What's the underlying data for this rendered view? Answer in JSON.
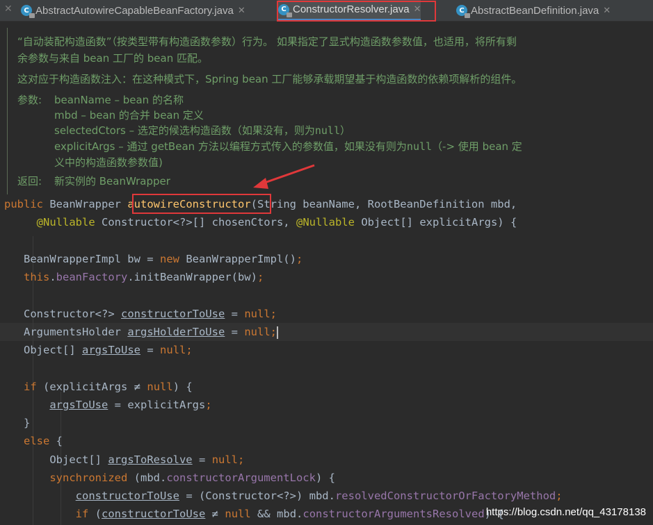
{
  "tabs": [
    {
      "label": "AbstractAutowireCapableBeanFactory.java",
      "icon": "C"
    },
    {
      "label": "ConstructorResolver.java",
      "icon": "C"
    },
    {
      "label": "AbstractBeanDefinition.java",
      "icon": "C"
    }
  ],
  "doc": {
    "line1": "“自动装配构造函数”（按类型带有构造函数参数）行为。 如果指定了显式构造函数参数值，也适用，将所有剩",
    "line2": "余参数与来自 bean 工厂的 bean 匹配。",
    "line3": "这对应于构造函数注入：在这种模式下，Spring bean 工厂能够承载期望基于构造函数的依赖项解析的组件。",
    "params_label": "参数:",
    "p1": "beanName – bean 的名称",
    "p2": "mbd – bean 的合并 bean 定义",
    "p3a": "selectedCtors – 选定的候选构造函数（如果没有，则为",
    "p3null": "null",
    "p3b": "）",
    "p4a": "explicitArgs – 通过 getBean 方法以编程方式传入的参数值，如果没有则为",
    "p4null": "null",
    "p4b": "（-> 使用 bean 定",
    "p5": "义中的构造函数参数值)",
    "returns_label": "返回:",
    "returns": "新实例的 BeanWrapper"
  },
  "code": {
    "kw_public": "public",
    "ret_type": "BeanWrapper",
    "method_name": "autowireConstructor",
    "sig_rest": "(String beanName, RootBeanDefinition mbd,",
    "ann_nullable": "@Nullable",
    "sig2_a": "Constructor<?>[] chosenCtors,",
    "sig2_b": "Object[] explicitArgs) {",
    "l4_a": "BeanWrapperImpl bw =",
    "kw_new": "new",
    "l4_b": "BeanWrapperImpl()",
    "semi": ";",
    "kw_this": "this",
    "dot": ".",
    "fld_beanFactory": "beanFactory",
    "l5_b": ".initBeanWrapper(bw)",
    "l7_a": "Constructor<?>",
    "var_constructorToUse": "constructorToUse",
    "eq": "=",
    "kw_null": "null",
    "l8_a": "ArgumentsHolder",
    "var_argsHolderToUse": "argsHolderToUse",
    "l9_a": "Object[]",
    "var_argsToUse": "argsToUse",
    "kw_if": "if",
    "l11_a": "(explicitArgs",
    "neq": "≠",
    "close_brace_open": ") {",
    "l12_b": "= explicitArgs",
    "rbrace": "}",
    "kw_else": "else",
    "lbrace": "{",
    "var_argsToResolve": "argsToResolve",
    "kw_synchronized": "synchronized",
    "l16_a": "(mbd.",
    "fld_lock": "constructorArgumentLock",
    "l17_b": "= (Constructor<?>) mbd.",
    "fld_resolved": "resolvedConstructorOrFactoryMethod",
    "l18_a": "(",
    "l18_b": "&& mbd.",
    "fld_args_resolved": "constructorArgumentsResolved",
    "l18_c": ") {"
  },
  "watermark": "https://blog.csdn.net/qq_43178138",
  "colors": {
    "keyword": "#cc7832",
    "field": "#9876aa",
    "annotation": "#bbb529",
    "method": "#ffc66d",
    "doc": "#6f9e68",
    "highlight_box": "#e0383a",
    "arrow": "#e0383a"
  }
}
